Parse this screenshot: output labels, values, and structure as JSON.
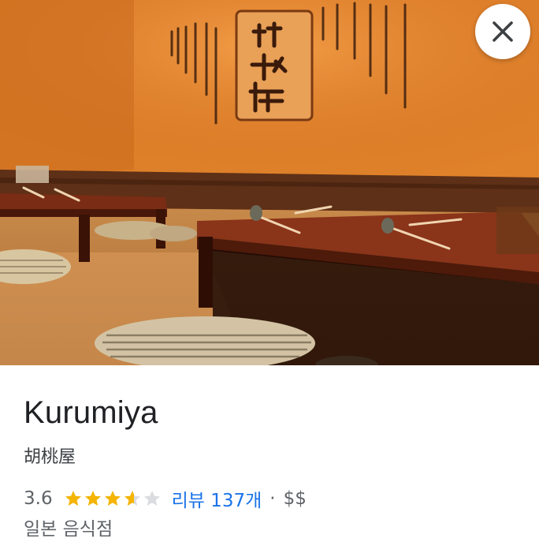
{
  "place": {
    "name": "Kurumiya",
    "native_name": "胡桃屋",
    "rating": "3.6",
    "rating_value": 3.6,
    "stars_max": 5,
    "reviews_label": "리뷰 137개",
    "separator": "·",
    "price_level": "$$",
    "category": "일본 음식점"
  },
  "photo": {
    "icon": "restaurant-interior-photo"
  },
  "controls": {
    "close_icon": "close-icon"
  },
  "colors": {
    "star_filled": "#f4b400",
    "star_empty": "#dadce0",
    "link": "#1a73e8",
    "text_primary": "#202124",
    "text_secondary": "#5f6368"
  }
}
